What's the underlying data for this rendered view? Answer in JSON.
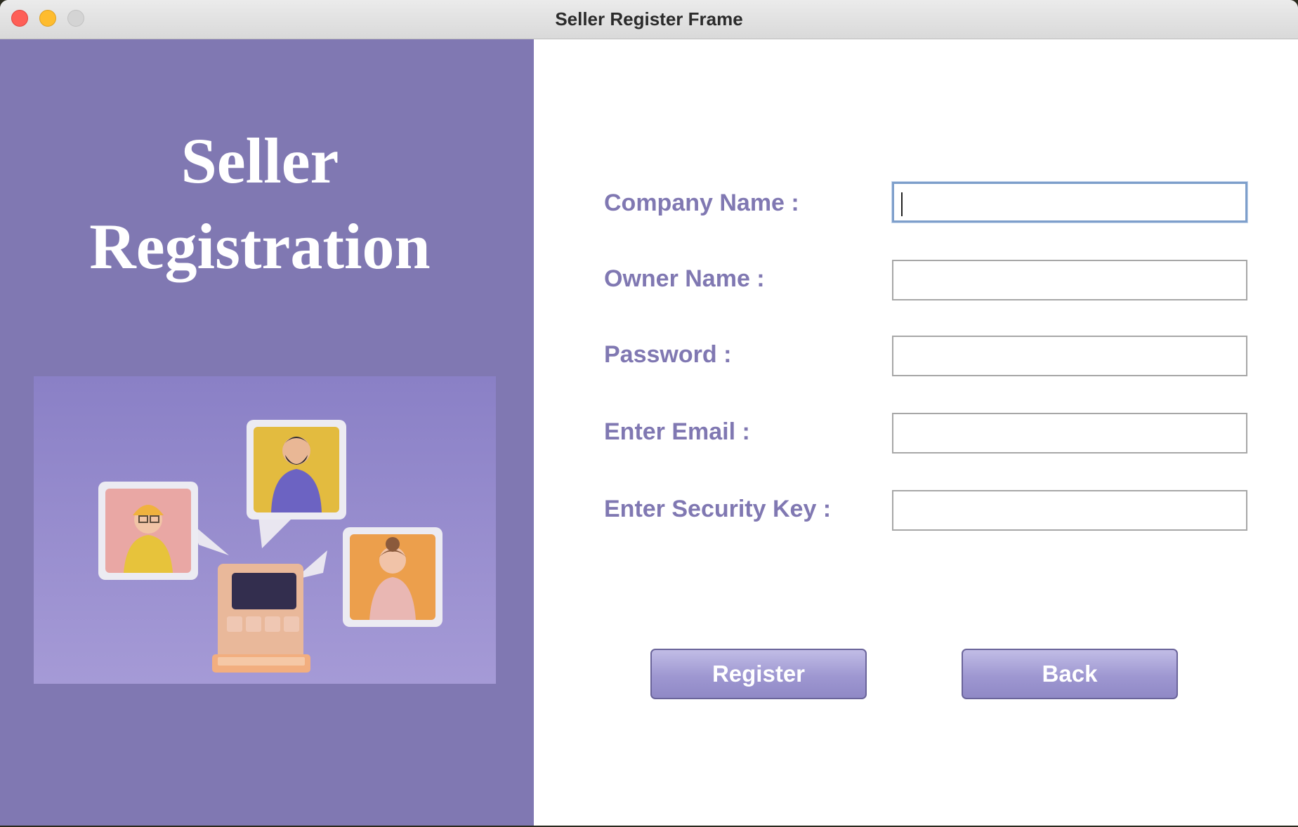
{
  "window": {
    "title": "Seller Register Frame"
  },
  "left_panel": {
    "heading_line1": "Seller",
    "heading_line2": "Registration",
    "illustration": "people-chat-laptop-illustration"
  },
  "form": {
    "fields": [
      {
        "label": "Company Name :",
        "value": "",
        "focused": true
      },
      {
        "label": "Owner Name :",
        "value": ""
      },
      {
        "label": "Password :",
        "value": ""
      },
      {
        "label": "Enter Email :",
        "value": ""
      },
      {
        "label": "Enter Security Key :",
        "value": ""
      }
    ],
    "register_label": "Register",
    "back_label": "Back"
  },
  "colors": {
    "accent": "#8078b2",
    "button": "#9e97d1"
  },
  "icons": [
    "close-icon",
    "minimize-icon",
    "zoom-icon"
  ]
}
